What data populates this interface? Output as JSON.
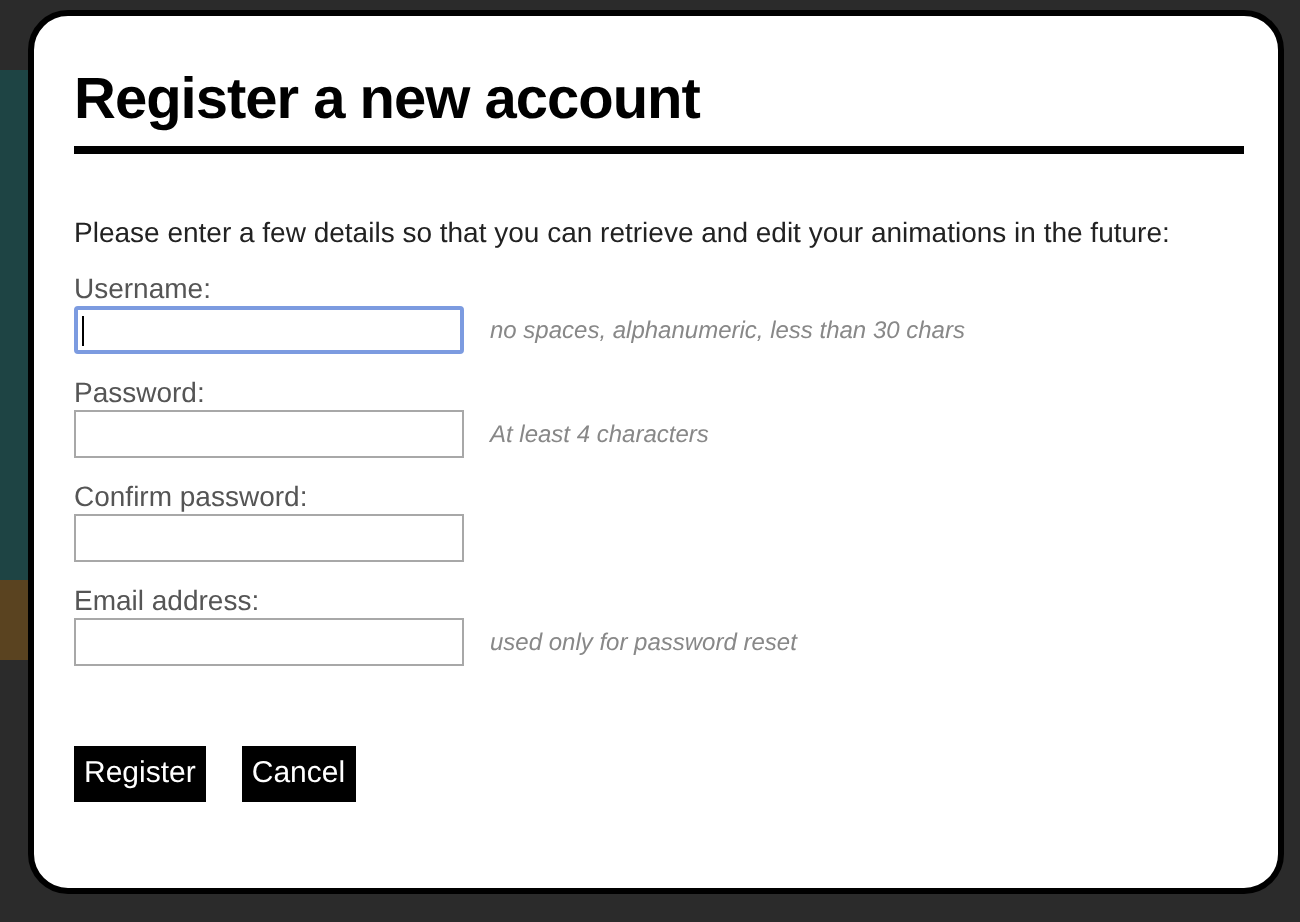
{
  "dialog": {
    "title": "Register a new account",
    "intro": "Please enter a few details so that you can retrieve and edit your animations in the future:",
    "fields": [
      {
        "label": "Username:",
        "hint": "no spaces, alphanumeric, less than 30 chars",
        "focused": true
      },
      {
        "label": "Password:",
        "hint": "At least 4 characters",
        "focused": false
      },
      {
        "label": "Confirm password:",
        "focused": false
      },
      {
        "label": "Email address:",
        "hint": "used only for password reset",
        "focused": false
      }
    ],
    "buttons": [
      "Register",
      "Cancel"
    ]
  }
}
